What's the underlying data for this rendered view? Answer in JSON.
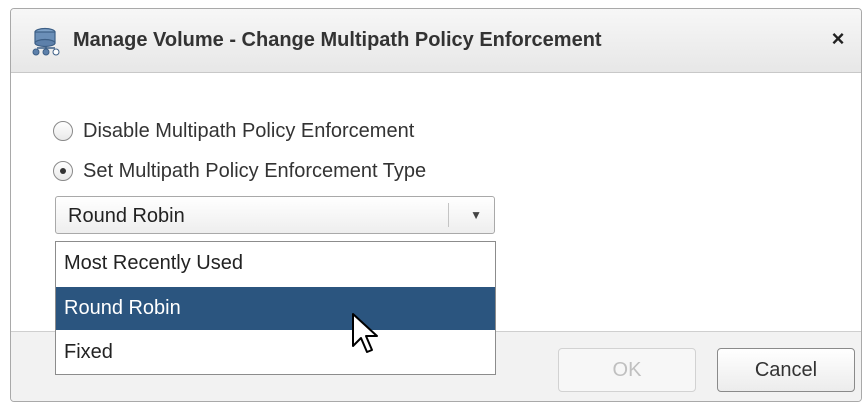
{
  "dialog": {
    "title": "Manage Volume - Change Multipath Policy Enforcement",
    "close_label": "×",
    "icon": "storage-volume-icon"
  },
  "options": {
    "disable_label": "Disable Multipath Policy Enforcement",
    "set_type_label": "Set Multipath Policy Enforcement Type",
    "selected_radio": "set_type"
  },
  "select": {
    "value": "Round Robin",
    "arrow": "▼",
    "items": [
      {
        "label": "Most Recently Used"
      },
      {
        "label": "Round Robin"
      },
      {
        "label": "Fixed"
      }
    ],
    "highlighted_index": 1
  },
  "footer": {
    "ok_label": "OK",
    "cancel_label": "Cancel"
  },
  "colors": {
    "highlight": "#2b557f",
    "title_text": "#333333"
  }
}
